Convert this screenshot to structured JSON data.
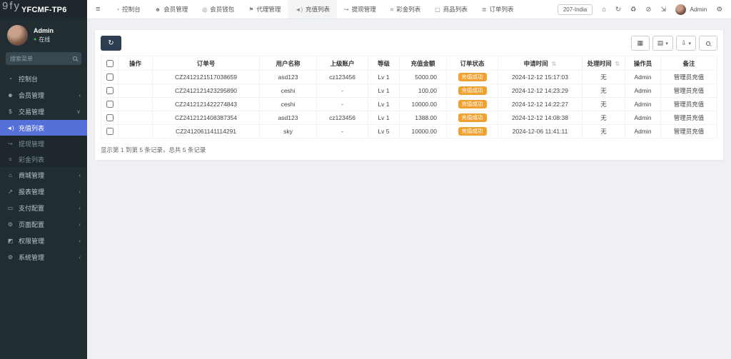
{
  "watermark": "9fy",
  "colors": {
    "accent_blue": "#5570d8",
    "badge_orange": "#efa131",
    "sidebar_bg": "#222d32",
    "online_green": "#3fb55e",
    "refresh_btn_dark": "#2c3e50"
  },
  "sidebar": {
    "logo": "YFCMF-TP6",
    "user_name": "Admin",
    "user_status": "在线",
    "status_dot": "●",
    "search_placeholder": "搜索菜单",
    "menu": [
      {
        "label": "控制台",
        "icon_name": "dashboard-icon",
        "glyph": "◔",
        "chevron": ""
      },
      {
        "label": "会员管理",
        "icon_name": "members-icon",
        "glyph": "☻",
        "chevron": "‹"
      },
      {
        "label": "交易管理",
        "icon_name": "trade-icon",
        "glyph": "$",
        "chevron": "∨"
      },
      {
        "label": "充值列表",
        "icon_name": "recharge-icon",
        "glyph": "◄)",
        "chevron": "",
        "sub": true,
        "active": true
      },
      {
        "label": "提现管理",
        "icon_name": "withdraw-icon",
        "glyph": "↪",
        "chevron": "",
        "sub": true
      },
      {
        "label": "彩金列表",
        "icon_name": "bonus-icon",
        "glyph": "¤",
        "chevron": "",
        "sub": true
      },
      {
        "label": "商城管理",
        "icon_name": "mall-icon",
        "glyph": "⌂",
        "chevron": "‹"
      },
      {
        "label": "报表管理",
        "icon_name": "report-icon",
        "glyph": "↗",
        "chevron": "‹"
      },
      {
        "label": "支付配置",
        "icon_name": "payment-icon",
        "glyph": "▭",
        "chevron": "‹"
      },
      {
        "label": "页面配置",
        "icon_name": "page-config-icon",
        "glyph": "⚙",
        "chevron": "‹"
      },
      {
        "label": "权限管理",
        "icon_name": "permission-icon",
        "glyph": "◩",
        "chevron": "‹"
      },
      {
        "label": "系统管理",
        "icon_name": "system-icon",
        "glyph": "⚙",
        "chevron": "‹"
      }
    ]
  },
  "topnav": {
    "hamburger": "≡",
    "tabs": [
      {
        "label": "控制台",
        "glyph": "◔"
      },
      {
        "label": "会员管理",
        "glyph": "☻"
      },
      {
        "label": "会员钱包",
        "glyph": "◎"
      },
      {
        "label": "代理管理",
        "glyph": "⚑"
      },
      {
        "label": "充值列表",
        "glyph": "◄)",
        "active": true
      },
      {
        "label": "提现管理",
        "glyph": "↪"
      },
      {
        "label": "彩金列表",
        "glyph": "¤"
      },
      {
        "label": "商品列表",
        "glyph": "▢"
      },
      {
        "label": "订单列表",
        "glyph": "≣"
      }
    ],
    "env_label": "207-India",
    "icons": {
      "home": "⌂",
      "refresh": "↻",
      "trash": "♻",
      "clear": "⊘",
      "expand": "⇲",
      "cogs": "⚙"
    },
    "user_label": "Admin"
  },
  "toolbar": {
    "refresh_glyph": "↻",
    "table_glyph": "▦",
    "columns_glyph": "▤",
    "export_glyph": "⇩",
    "caret": "▾"
  },
  "table": {
    "sort_glyph": "⇅",
    "columns": [
      "",
      "操作",
      "订单号",
      "用户名称",
      "上级账户",
      "等级",
      "充值金额",
      "订单状态",
      "申请时间",
      "处理时间",
      "操作员",
      "备注"
    ],
    "rows": [
      {
        "op": "",
        "order_no": "CZ2412121517038659",
        "user": "asd123",
        "parent": "cz123456",
        "level": "Lv 1",
        "amount": "5000.00",
        "status": "充值成功",
        "apply_time": "2024-12-12 15:17:03",
        "handle_time": "无",
        "operator": "Admin",
        "remark": "管理员充值"
      },
      {
        "op": "",
        "order_no": "CZ2412121423295890",
        "user": "ceshi",
        "parent": "-",
        "level": "Lv 1",
        "amount": "100.00",
        "status": "充值成功",
        "apply_time": "2024-12-12 14:23:29",
        "handle_time": "无",
        "operator": "Admin",
        "remark": "管理员充值"
      },
      {
        "op": "",
        "order_no": "CZ2412121422274843",
        "user": "ceshi",
        "parent": "-",
        "level": "Lv 1",
        "amount": "10000.00",
        "status": "充值成功",
        "apply_time": "2024-12-12 14:22:27",
        "handle_time": "无",
        "operator": "Admin",
        "remark": "管理员充值"
      },
      {
        "op": "",
        "order_no": "CZ2412121408387354",
        "user": "asd123",
        "parent": "cz123456",
        "level": "Lv 1",
        "amount": "1388.00",
        "status": "充值成功",
        "apply_time": "2024-12-12 14:08:38",
        "handle_time": "无",
        "operator": "Admin",
        "remark": "管理员充值"
      },
      {
        "op": "",
        "order_no": "CZ2412061141114291",
        "user": "sky",
        "parent": "-",
        "level": "Lv 5",
        "amount": "10000.00",
        "status": "充值成功",
        "apply_time": "2024-12-06 11:41:11",
        "handle_time": "无",
        "operator": "Admin",
        "remark": "管理员充值"
      }
    ],
    "summary": "显示第 1 到第 5 条记录，总共 5 条记录"
  }
}
